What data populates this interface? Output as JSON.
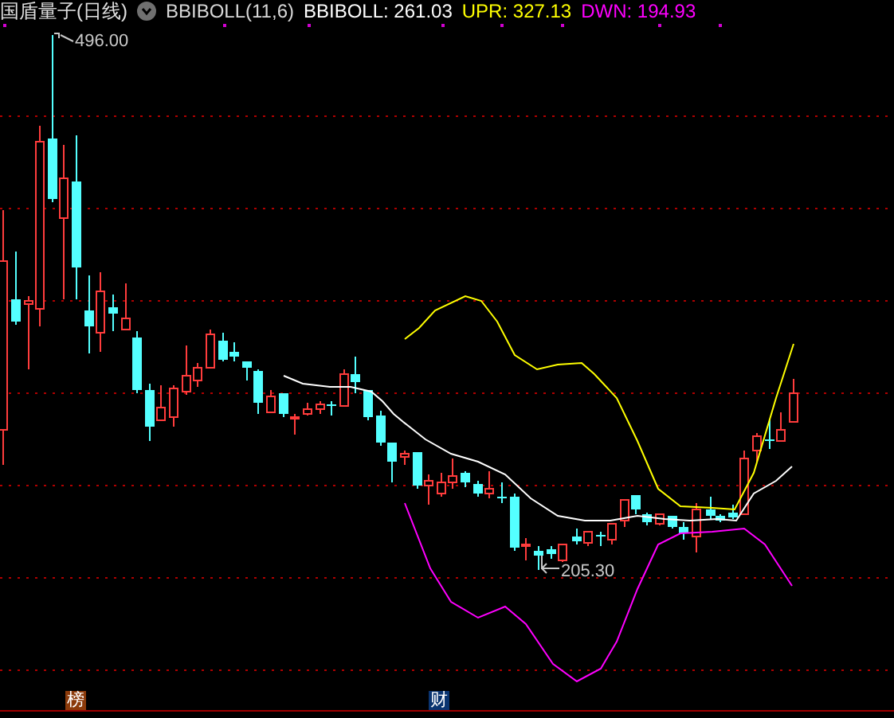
{
  "title": "国盾量子(日线)",
  "indicator": {
    "name": "BBIBOLL(11,6)",
    "values": [
      {
        "label": "BBIBOLL: 261.03",
        "color": "#ffffff"
      },
      {
        "label": "UPR: 327.13",
        "color": "#ffff00"
      },
      {
        "label": "DWN: 194.93",
        "color": "#ff00ff"
      }
    ]
  },
  "chart": {
    "high_label": "496.00",
    "low_label": "205.30"
  },
  "markers": [
    {
      "label": "榜",
      "color": "#8b3a0a"
    },
    {
      "label": "财",
      "color": "#0a3470"
    }
  ]
}
